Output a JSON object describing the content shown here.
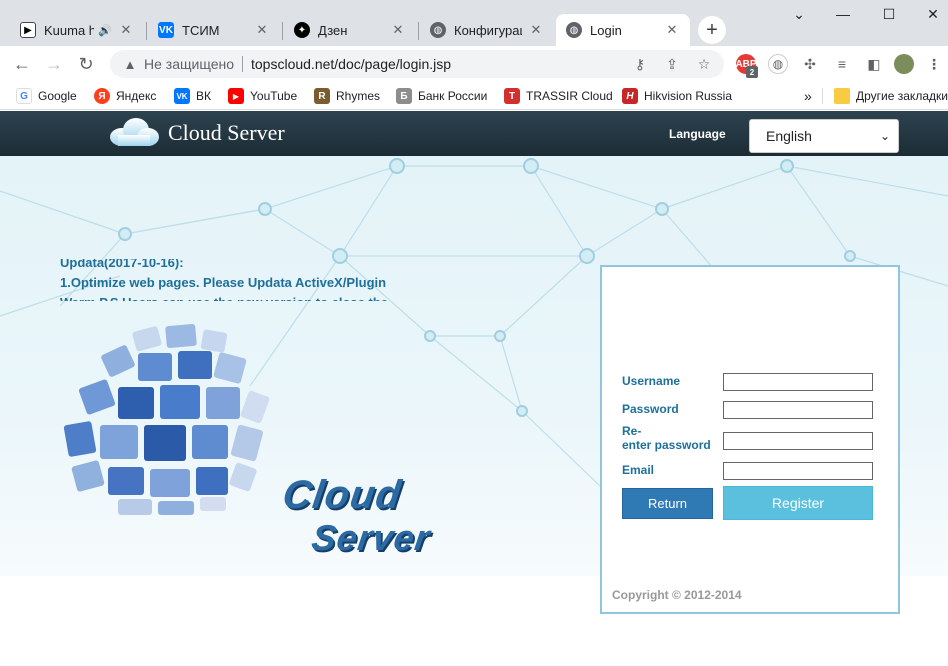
{
  "browser": {
    "tabs": [
      {
        "title": "Kuuma hu",
        "active": false,
        "audio": true
      },
      {
        "title": "ТСИМ",
        "active": false
      },
      {
        "title": "Дзен",
        "active": false
      },
      {
        "title": "Конфигурация",
        "active": false
      },
      {
        "title": "Login",
        "active": true
      }
    ],
    "window_controls": {
      "minimize": "⌄",
      "restore": "—",
      "maximize": "☐",
      "close": "✕"
    },
    "address": {
      "security_text": "Не защищено",
      "url": "topscloud.net/doc/page/login.jsp"
    },
    "extension_badge": "2",
    "bookmarks": [
      {
        "label": "Google",
        "color": "#4285f4",
        "glyph": "G"
      },
      {
        "label": "Яндекс",
        "color": "#fc3f1d",
        "glyph": "Я"
      },
      {
        "label": "ВК",
        "color": "#0077ff",
        "glyph": "VK"
      },
      {
        "label": "YouTube",
        "color": "#ff0000",
        "glyph": "▶"
      },
      {
        "label": "Rhymes",
        "color": "#7a5c2e",
        "glyph": "R"
      },
      {
        "label": "Банк России",
        "color": "#7b7b7b",
        "glyph": "Б"
      },
      {
        "label": "TRASSIR Cloud",
        "color": "#d32f2f",
        "glyph": "T"
      },
      {
        "label": "Hikvision Russia",
        "color": "#c62828",
        "glyph": "H"
      }
    ],
    "bookmarks_more": "»",
    "other_bookmarks": "Другие закладки"
  },
  "site": {
    "title": "Cloud Server",
    "language_label": "Language",
    "language_value": "English",
    "news": [
      "Updata(2017-10-16):",
      "1.Optimize web pages. Please Updata ActiveX/Plugin",
      "Warm P.S Users can use the new version to close the"
    ],
    "logo_line1": "Cloud",
    "logo_line2": "Server"
  },
  "login": {
    "username_label": "Username",
    "password_label": "Password",
    "reenter_label_1": "Re-",
    "reenter_label_2": "enter password",
    "email_label": "Email",
    "return_button": "Return",
    "register_button": "Register",
    "copyright": "Copyright © 2012-2014"
  },
  "colors": {
    "header_bg": "#1c2c35",
    "label_blue": "#1e6f99",
    "return_btn": "#2f79b5",
    "register_btn": "#5bc0de",
    "login_border": "#8fc6dd"
  }
}
